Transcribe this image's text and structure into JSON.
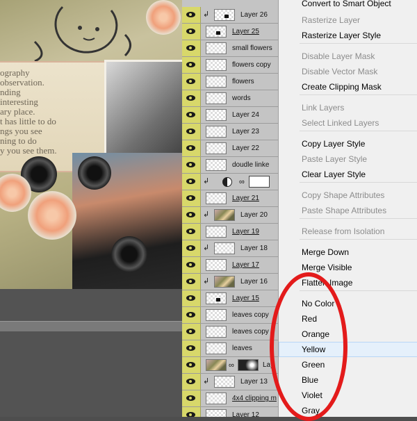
{
  "canvas": {
    "text_lines": [
      "ography",
      "observation.",
      "nding",
      "interesting",
      "ary place.",
      "t has little to do",
      "ngs you see",
      "ning to do",
      "y you see them."
    ]
  },
  "layers": [
    {
      "name": "Layer 26",
      "clip": true,
      "underline": false,
      "thumb": "mark"
    },
    {
      "name": "Layer 25",
      "clip": false,
      "underline": true,
      "thumb": "mark"
    },
    {
      "name": "small flowers",
      "clip": false,
      "underline": false,
      "thumb": "plain"
    },
    {
      "name": "flowers copy",
      "clip": false,
      "underline": false,
      "thumb": "plain"
    },
    {
      "name": "flowers",
      "clip": false,
      "underline": false,
      "thumb": "plain"
    },
    {
      "name": "words",
      "clip": false,
      "underline": false,
      "thumb": "plain"
    },
    {
      "name": "Layer 24",
      "clip": false,
      "underline": false,
      "thumb": "plain"
    },
    {
      "name": "Layer 23",
      "clip": false,
      "underline": false,
      "thumb": "plain"
    },
    {
      "name": "Layer 22",
      "clip": false,
      "underline": false,
      "thumb": "plain"
    },
    {
      "name": "doudle linke",
      "clip": false,
      "underline": false,
      "thumb": "plain"
    },
    {
      "name": "",
      "clip": true,
      "underline": false,
      "thumb": "adjustment"
    },
    {
      "name": "Layer 21",
      "clip": false,
      "underline": true,
      "thumb": "plain"
    },
    {
      "name": "Layer 20",
      "clip": true,
      "underline": false,
      "thumb": "busy"
    },
    {
      "name": "Layer 19",
      "clip": false,
      "underline": true,
      "thumb": "plain"
    },
    {
      "name": "Layer 18",
      "clip": true,
      "underline": false,
      "thumb": "plain"
    },
    {
      "name": "Layer 17",
      "clip": false,
      "underline": true,
      "thumb": "plain"
    },
    {
      "name": "Layer 16",
      "clip": true,
      "underline": false,
      "thumb": "busy"
    },
    {
      "name": "Layer 15",
      "clip": false,
      "underline": true,
      "thumb": "mark"
    },
    {
      "name": "leaves copy",
      "clip": false,
      "underline": false,
      "thumb": "plain"
    },
    {
      "name": "leaves copy",
      "clip": false,
      "underline": false,
      "thumb": "plain"
    },
    {
      "name": "leaves",
      "clip": false,
      "underline": false,
      "thumb": "plain"
    },
    {
      "name": "Lay",
      "clip": false,
      "underline": false,
      "thumb": "masked"
    },
    {
      "name": "Layer 13",
      "clip": true,
      "underline": false,
      "thumb": "plain"
    },
    {
      "name": "4x4 clipping m",
      "clip": false,
      "underline": true,
      "thumb": "plain"
    },
    {
      "name": "Layer 12",
      "clip": false,
      "underline": false,
      "thumb": "plain"
    }
  ],
  "menu": {
    "items": [
      {
        "label": "Convert to Smart Object",
        "disabled": false,
        "highlight": false
      },
      {
        "label": "Rasterize Layer",
        "disabled": true,
        "highlight": false
      },
      {
        "label": "Rasterize Layer Style",
        "disabled": false,
        "highlight": false
      },
      {
        "label": "Disable Layer Mask",
        "disabled": true,
        "highlight": false
      },
      {
        "label": "Disable Vector Mask",
        "disabled": true,
        "highlight": false
      },
      {
        "label": "Create Clipping Mask",
        "disabled": false,
        "highlight": false
      },
      {
        "label": "Link Layers",
        "disabled": true,
        "highlight": false
      },
      {
        "label": "Select Linked Layers",
        "disabled": true,
        "highlight": false
      },
      {
        "label": "Copy Layer Style",
        "disabled": false,
        "highlight": false
      },
      {
        "label": "Paste Layer Style",
        "disabled": true,
        "highlight": false
      },
      {
        "label": "Clear Layer Style",
        "disabled": false,
        "highlight": false
      },
      {
        "label": "Copy Shape Attributes",
        "disabled": true,
        "highlight": false
      },
      {
        "label": "Paste Shape Attributes",
        "disabled": true,
        "highlight": false
      },
      {
        "label": "Release from Isolation",
        "disabled": true,
        "highlight": false
      },
      {
        "label": "Merge Down",
        "disabled": false,
        "highlight": false
      },
      {
        "label": "Merge Visible",
        "disabled": false,
        "highlight": false
      },
      {
        "label": "Flatten Image",
        "disabled": false,
        "highlight": false
      },
      {
        "label": "No Color",
        "disabled": false,
        "highlight": false
      },
      {
        "label": "Red",
        "disabled": false,
        "highlight": false
      },
      {
        "label": "Orange",
        "disabled": false,
        "highlight": false
      },
      {
        "label": "Yellow",
        "disabled": false,
        "highlight": true
      },
      {
        "label": "Green",
        "disabled": false,
        "highlight": false
      },
      {
        "label": "Blue",
        "disabled": false,
        "highlight": false
      },
      {
        "label": "Violet",
        "disabled": false,
        "highlight": false
      },
      {
        "label": "Gray",
        "disabled": false,
        "highlight": false
      }
    ]
  },
  "colors": {
    "layer_color_yellow": "#d8d86a",
    "annotation_red": "#e31b1b",
    "menu_highlight": "#e5f0fb"
  }
}
